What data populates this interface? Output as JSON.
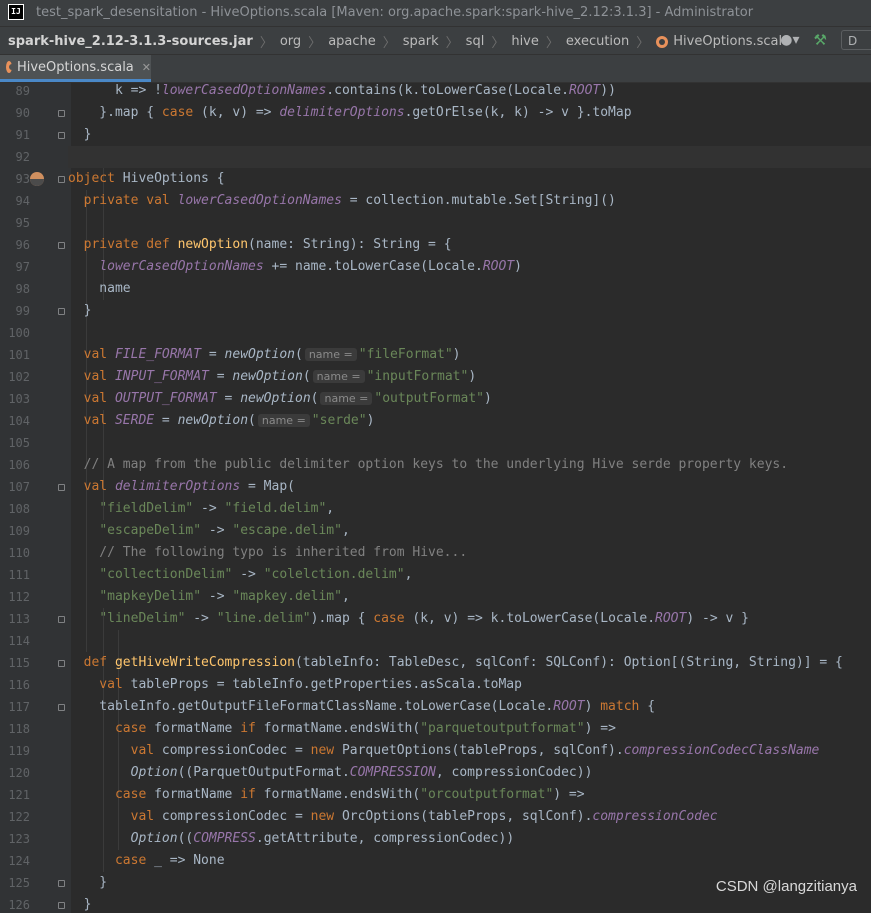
{
  "window": {
    "title": "test_spark_desensitation - HiveOptions.scala [Maven: org.apache.spark:spark-hive_2.12:3.1.3] - Administrator",
    "logo_text": "IJ"
  },
  "breadcrumb": [
    "spark-hive_2.12-3.1.3-sources.jar",
    "org",
    "apache",
    "spark",
    "sql",
    "hive",
    "execution",
    "HiveOptions.scala"
  ],
  "toolbar": {
    "user_icon": "user-icon",
    "build_icon": "hammer-icon",
    "device_label": "D"
  },
  "tabs": [
    {
      "label": "HiveOptions.scala",
      "active": true
    }
  ],
  "colors": {
    "keyword": "#cc7832",
    "string": "#6a8759",
    "field": "#9876aa",
    "function": "#ffc66d",
    "comment": "#808080",
    "text": "#a9b7c6",
    "background": "#2b2b2b"
  },
  "code": {
    "current_line": 92,
    "lines": [
      {
        "n": 89,
        "tokens": [
          [
            "t",
            "      k => !"
          ],
          [
            "i",
            "lowerCasedOptionNames"
          ],
          [
            "t",
            ".contains(k.toLowerCase(Locale."
          ],
          [
            "i",
            "ROOT"
          ],
          [
            "t",
            "))"
          ]
        ]
      },
      {
        "n": 90,
        "tokens": [
          [
            "t",
            "    }.map { "
          ],
          [
            "k",
            "case"
          ],
          [
            "t",
            " (k, v) => "
          ],
          [
            "i",
            "delimiterOptions"
          ],
          [
            "t",
            ".getOrElse(k, k) -> v }.toMap"
          ]
        ]
      },
      {
        "n": 91,
        "tokens": [
          [
            "t",
            "  }"
          ]
        ]
      },
      {
        "n": 92,
        "tokens": []
      },
      {
        "n": 93,
        "tokens": [
          [
            "k",
            "object"
          ],
          [
            "t",
            " HiveOptions {"
          ]
        ]
      },
      {
        "n": 94,
        "tokens": [
          [
            "k",
            "  private val "
          ],
          [
            "i",
            "lowerCasedOptionNames"
          ],
          [
            "t",
            " = collection.mutable.Set[String]()"
          ]
        ]
      },
      {
        "n": 95,
        "tokens": []
      },
      {
        "n": 96,
        "tokens": [
          [
            "k",
            "  private def "
          ],
          [
            "f",
            "newOption"
          ],
          [
            "t",
            "(name: String): String = {"
          ]
        ]
      },
      {
        "n": 97,
        "tokens": [
          [
            "t",
            "    "
          ],
          [
            "i",
            "lowerCasedOptionNames"
          ],
          [
            "t",
            " += name.toLowerCase(Locale."
          ],
          [
            "i",
            "ROOT"
          ],
          [
            "t",
            ")"
          ]
        ]
      },
      {
        "n": 98,
        "tokens": [
          [
            "t",
            "    name"
          ]
        ]
      },
      {
        "n": 99,
        "tokens": [
          [
            "t",
            "  }"
          ]
        ]
      },
      {
        "n": 100,
        "tokens": []
      },
      {
        "n": 101,
        "tokens": [
          [
            "k",
            "  val "
          ],
          [
            "i",
            "FILE_FORMAT"
          ],
          [
            "t",
            " = "
          ],
          [
            "ii",
            "newOption"
          ],
          [
            "t",
            "("
          ],
          [
            "h",
            "name ="
          ],
          [
            "s",
            "\"fileFormat\""
          ],
          [
            "t",
            ")"
          ]
        ]
      },
      {
        "n": 102,
        "tokens": [
          [
            "k",
            "  val "
          ],
          [
            "i",
            "INPUT_FORMAT"
          ],
          [
            "t",
            " = "
          ],
          [
            "ii",
            "newOption"
          ],
          [
            "t",
            "("
          ],
          [
            "h",
            "name ="
          ],
          [
            "s",
            "\"inputFormat\""
          ],
          [
            "t",
            ")"
          ]
        ]
      },
      {
        "n": 103,
        "tokens": [
          [
            "k",
            "  val "
          ],
          [
            "i",
            "OUTPUT_FORMAT"
          ],
          [
            "t",
            " = "
          ],
          [
            "ii",
            "newOption"
          ],
          [
            "t",
            "("
          ],
          [
            "h",
            "name ="
          ],
          [
            "s",
            "\"outputFormat\""
          ],
          [
            "t",
            ")"
          ]
        ]
      },
      {
        "n": 104,
        "tokens": [
          [
            "k",
            "  val "
          ],
          [
            "i",
            "SERDE"
          ],
          [
            "t",
            " = "
          ],
          [
            "ii",
            "newOption"
          ],
          [
            "t",
            "("
          ],
          [
            "h",
            "name ="
          ],
          [
            "s",
            "\"serde\""
          ],
          [
            "t",
            ")"
          ]
        ]
      },
      {
        "n": 105,
        "tokens": []
      },
      {
        "n": 106,
        "tokens": [
          [
            "c",
            "  // A map from the public delimiter option keys to the underlying Hive serde property keys."
          ]
        ]
      },
      {
        "n": 107,
        "tokens": [
          [
            "k",
            "  val "
          ],
          [
            "i",
            "delimiterOptions"
          ],
          [
            "t",
            " = Map("
          ]
        ]
      },
      {
        "n": 108,
        "tokens": [
          [
            "t",
            "    "
          ],
          [
            "s",
            "\"fieldDelim\""
          ],
          [
            "t",
            " -> "
          ],
          [
            "s",
            "\"field.delim\""
          ],
          [
            "t",
            ","
          ]
        ]
      },
      {
        "n": 109,
        "tokens": [
          [
            "t",
            "    "
          ],
          [
            "s",
            "\"escapeDelim\""
          ],
          [
            "t",
            " -> "
          ],
          [
            "s",
            "\"escape.delim\""
          ],
          [
            "t",
            ","
          ]
        ]
      },
      {
        "n": 110,
        "tokens": [
          [
            "c",
            "    // The following typo is inherited from Hive..."
          ]
        ]
      },
      {
        "n": 111,
        "tokens": [
          [
            "t",
            "    "
          ],
          [
            "s",
            "\"collectionDelim\""
          ],
          [
            "t",
            " -> "
          ],
          [
            "s",
            "\"colelction.delim\""
          ],
          [
            "t",
            ","
          ]
        ]
      },
      {
        "n": 112,
        "tokens": [
          [
            "t",
            "    "
          ],
          [
            "s",
            "\"mapkeyDelim\""
          ],
          [
            "t",
            " -> "
          ],
          [
            "s",
            "\"mapkey.delim\""
          ],
          [
            "t",
            ","
          ]
        ]
      },
      {
        "n": 113,
        "tokens": [
          [
            "t",
            "    "
          ],
          [
            "s",
            "\"lineDelim\""
          ],
          [
            "t",
            " -> "
          ],
          [
            "s",
            "\"line.delim\""
          ],
          [
            "t",
            ").map { "
          ],
          [
            "k",
            "case"
          ],
          [
            "t",
            " (k, v) => k.toLowerCase(Locale."
          ],
          [
            "i",
            "ROOT"
          ],
          [
            "t",
            ") -> v }"
          ]
        ]
      },
      {
        "n": 114,
        "tokens": []
      },
      {
        "n": 115,
        "tokens": [
          [
            "k",
            "  def "
          ],
          [
            "f",
            "getHiveWriteCompression"
          ],
          [
            "t",
            "(tableInfo: TableDesc, sqlConf: SQLConf): Option[(String, String)] = {"
          ]
        ]
      },
      {
        "n": 116,
        "tokens": [
          [
            "k",
            "    val "
          ],
          [
            "t",
            "tableProps = tableInfo.getProperties.asScala.toMap"
          ]
        ]
      },
      {
        "n": 117,
        "tokens": [
          [
            "t",
            "    tableInfo.getOutputFileFormatClassName.toLowerCase(Locale."
          ],
          [
            "i",
            "ROOT"
          ],
          [
            "t",
            ") "
          ],
          [
            "k",
            "match"
          ],
          [
            "t",
            " {"
          ]
        ]
      },
      {
        "n": 118,
        "tokens": [
          [
            "k",
            "      case "
          ],
          [
            "t",
            "formatName "
          ],
          [
            "k",
            "if "
          ],
          [
            "t",
            "formatName.endsWith("
          ],
          [
            "s",
            "\"parquetoutputformat\""
          ],
          [
            "t",
            ") =>"
          ]
        ]
      },
      {
        "n": 119,
        "tokens": [
          [
            "k",
            "        val "
          ],
          [
            "t",
            "compressionCodec = "
          ],
          [
            "k",
            "new "
          ],
          [
            "t",
            "ParquetOptions(tableProps, sqlConf)."
          ],
          [
            "i",
            "compressionCodecClassName"
          ]
        ]
      },
      {
        "n": 120,
        "tokens": [
          [
            "t",
            "        "
          ],
          [
            "ii",
            "Option"
          ],
          [
            "t",
            "((ParquetOutputFormat."
          ],
          [
            "i",
            "COMPRESSION"
          ],
          [
            "t",
            ", compressionCodec))"
          ]
        ]
      },
      {
        "n": 121,
        "tokens": [
          [
            "k",
            "      case "
          ],
          [
            "t",
            "formatName "
          ],
          [
            "k",
            "if "
          ],
          [
            "t",
            "formatName.endsWith("
          ],
          [
            "s",
            "\"orcoutputformat\""
          ],
          [
            "t",
            ") =>"
          ]
        ]
      },
      {
        "n": 122,
        "tokens": [
          [
            "k",
            "        val "
          ],
          [
            "t",
            "compressionCodec = "
          ],
          [
            "k",
            "new "
          ],
          [
            "t",
            "OrcOptions(tableProps, sqlConf)."
          ],
          [
            "i",
            "compressionCodec"
          ]
        ]
      },
      {
        "n": 123,
        "tokens": [
          [
            "t",
            "        "
          ],
          [
            "ii",
            "Option"
          ],
          [
            "t",
            "(("
          ],
          [
            "i",
            "COMPRESS"
          ],
          [
            "t",
            ".getAttribute, compressionCodec))"
          ]
        ]
      },
      {
        "n": 124,
        "tokens": [
          [
            "k",
            "      case "
          ],
          [
            "t",
            "_ => None"
          ]
        ]
      },
      {
        "n": 125,
        "tokens": [
          [
            "t",
            "    }"
          ]
        ]
      },
      {
        "n": 126,
        "tokens": [
          [
            "t",
            "  }"
          ]
        ]
      }
    ]
  },
  "watermark": "CSDN @langzitianya"
}
